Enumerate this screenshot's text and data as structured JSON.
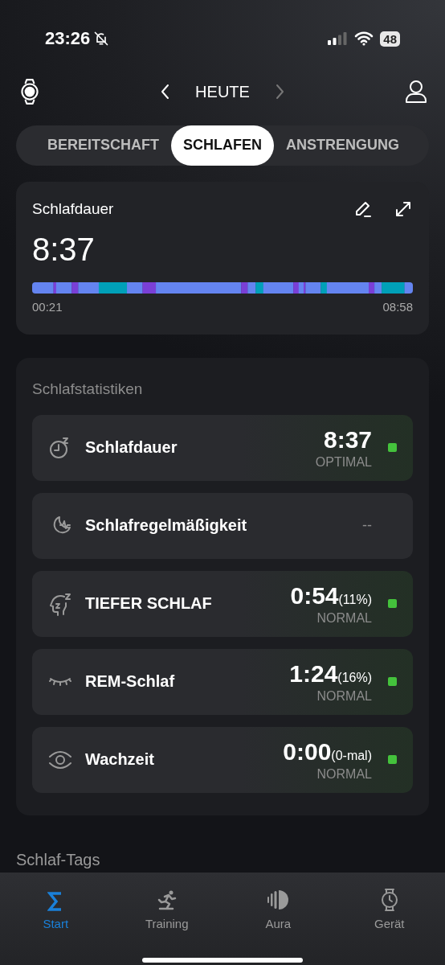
{
  "status_bar": {
    "time": "23:26",
    "muted": true,
    "battery": "48"
  },
  "header": {
    "title": "HEUTE",
    "next_disabled": true
  },
  "tabs": [
    {
      "label": "BEREITSCHAFT",
      "selected": false
    },
    {
      "label": "SCHLAFEN",
      "selected": true
    },
    {
      "label": "ANSTRENGUNG",
      "selected": false
    }
  ],
  "duration_card": {
    "title": "Schlafdauer",
    "value": "8:37",
    "start": "00:21",
    "end": "08:58"
  },
  "stats": {
    "title": "Schlafstatistiken",
    "rows": [
      {
        "kind": "clock",
        "label": "Schlafdauer",
        "value": "8:37",
        "rating": "OPTIMAL",
        "color": "#44c23c"
      },
      {
        "kind": "moon",
        "label": "Schlafregelmäßigkeit",
        "value": "--"
      },
      {
        "kind": "head",
        "label": "TIEFER SCHLAF",
        "value": "0:54",
        "detail": "(11%)",
        "rating": "NORMAL",
        "color": "#44c23c"
      },
      {
        "kind": "lashes",
        "label": "REM-Schlaf",
        "value": "1:24",
        "detail": "(16%)",
        "rating": "NORMAL",
        "color": "#44c23c"
      },
      {
        "kind": "eye",
        "label": "Wachzeit",
        "value": "0:00",
        "detail": "(0-mal)",
        "rating": "NORMAL",
        "color": "#44c23c"
      }
    ]
  },
  "tags_title": "Schlaf-Tags",
  "nav": [
    {
      "kind": "sigma",
      "label": "Start",
      "selected": true
    },
    {
      "kind": "runner",
      "label": "Training",
      "selected": false
    },
    {
      "kind": "aura",
      "label": "Aura",
      "selected": false
    },
    {
      "kind": "watch",
      "label": "Gerät",
      "selected": false
    }
  ]
}
